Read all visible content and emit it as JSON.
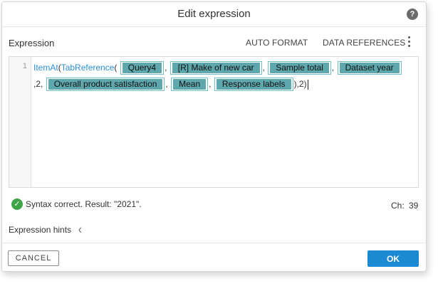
{
  "dialog": {
    "title": "Edit expression",
    "help_icon": "question-mark-icon"
  },
  "header": {
    "label": "Expression",
    "auto_format": "AUTO FORMAT",
    "data_references": "DATA REFERENCES",
    "more_icon": "kebab-menu-icon"
  },
  "editor": {
    "line_number": "1",
    "function_outer": "ItemAt",
    "open_paren_outer": "(",
    "function_inner": "TabReference",
    "open_paren_inner": "(",
    "references": [
      "Query4",
      "[R] Make of new car",
      "Sample total",
      "Dataset year",
      "Overall product satisfaction",
      "Mean",
      "Response labels"
    ],
    "separator": ",",
    "literal_1": ",2,",
    "tail": "),2)"
  },
  "status": {
    "icon": "check-circle-icon",
    "message": "Syntax correct. Result: \"2021\".",
    "ch_label": "Ch:",
    "ch_value": "39",
    "color": "#3da447"
  },
  "hints": {
    "label": "Expression hints",
    "icon": "chevron-left-icon"
  },
  "footer": {
    "cancel_label": "CANCEL",
    "ok_label": "OK",
    "ok_color": "#1b8ad3"
  },
  "colors": {
    "function": "#2b8fd6",
    "reference_chip": "#5da7ad",
    "reference_border": "#74c0c9"
  }
}
